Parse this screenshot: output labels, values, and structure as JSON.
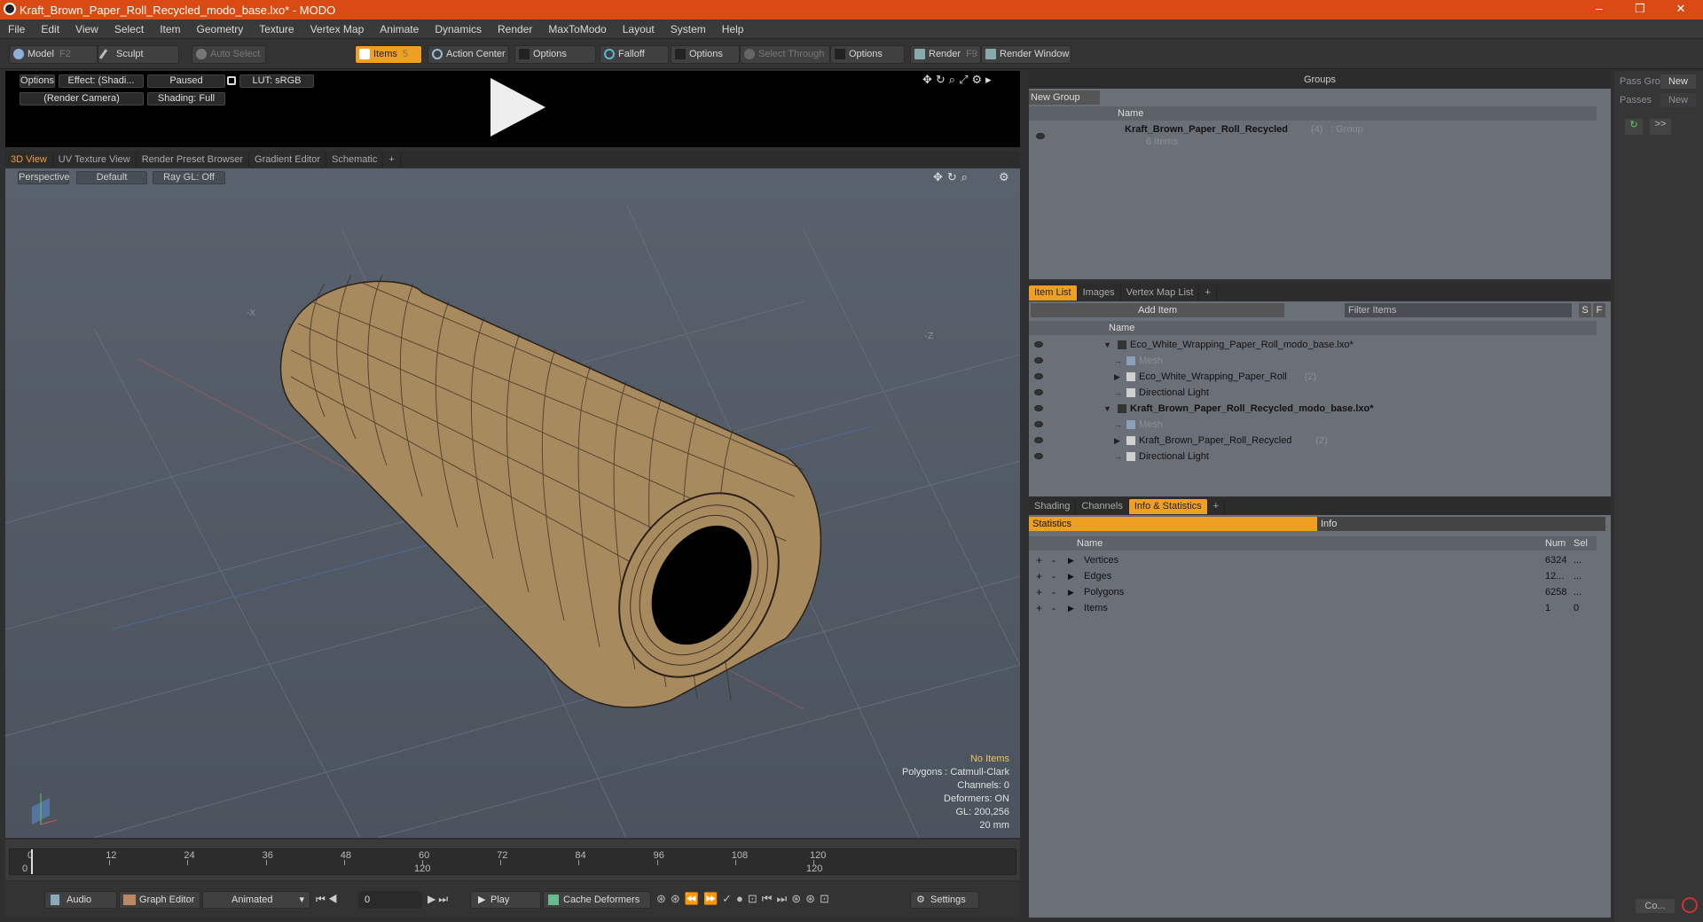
{
  "window": {
    "title": "Kraft_Brown_Paper_Roll_Recycled_modo_base.lxo* - MODO",
    "minimize": "–",
    "maximize": "❐",
    "close": "✕"
  },
  "menu": [
    "File",
    "Edit",
    "View",
    "Select",
    "Item",
    "Geometry",
    "Texture",
    "Vertex Map",
    "Animate",
    "Dynamics",
    "Render",
    "MaxToModo",
    "Layout",
    "System",
    "Help"
  ],
  "toolbar": {
    "model": "Model",
    "model_key": "F2",
    "sculpt": "Sculpt",
    "auto_select": "Auto Select",
    "items": "Items",
    "items_key": "5",
    "action_center": "Action Center",
    "options1": "Options",
    "falloff": "Falloff",
    "options2": "Options",
    "select_through": "Select Through",
    "options3": "Options",
    "render": "Render",
    "render_key": "F9",
    "render_window": "Render Window"
  },
  "preview": {
    "options": "Options",
    "effect": "Effect: (Shadi...",
    "paused": "Paused",
    "lut": "LUT: sRGB",
    "camera": "(Render Camera)",
    "shading": "Shading: Full"
  },
  "viewport_tabs": [
    "3D View",
    "UV Texture View",
    "Render Preset Browser",
    "Gradient Editor",
    "Schematic",
    "+"
  ],
  "viewport": {
    "perspective": "Perspective",
    "default": "Default",
    "raygl": "Ray GL: Off",
    "axis_x": "-X",
    "axis_z": "-Z"
  },
  "overlay": {
    "no_items": "No Items",
    "polygons": "Polygons : Catmull-Clark",
    "channels": "Channels: 0",
    "deformers": "Deformers: ON",
    "gl": "GL: 200,256",
    "units": "20 mm"
  },
  "timeline": {
    "ticks": [
      "0",
      "12",
      "24",
      "36",
      "48",
      "60",
      "72",
      "84",
      "96",
      "108",
      "120"
    ],
    "lower": [
      "0",
      "120",
      "120"
    ]
  },
  "bottom": {
    "audio": "Audio",
    "graph_editor": "Graph Editor",
    "animated": "Animated",
    "frame": "0",
    "play": "Play",
    "cache_deformers": "Cache Deformers",
    "settings": "Settings"
  },
  "groups": {
    "title": "Groups",
    "new_group": "New Group",
    "col_name": "Name",
    "item_name": "Kraft_Brown_Paper_Roll_Recycled",
    "item_count": "(4)",
    "item_type": ": Group",
    "item_sub": "6 Items"
  },
  "right_strip": {
    "pass_groups": "Pass Gro",
    "new1": "New",
    "passes": "Passes",
    "new2": "New",
    "more": ">>",
    "co": "Co..."
  },
  "item_list": {
    "tabs": [
      "Item List",
      "Images",
      "Vertex Map List",
      "+"
    ],
    "add_item": "Add Item",
    "filter": "Filter Items",
    "s": "S",
    "f": "F",
    "col_name": "Name",
    "rows": [
      {
        "label": "Eco_White_Wrapping_Paper_Roll_modo_base.lxo*",
        "indent": 0,
        "style": "normal"
      },
      {
        "label": "Mesh",
        "indent": 2,
        "style": "dim"
      },
      {
        "label": "Eco_White_Wrapping_Paper_Roll",
        "count": "(2)",
        "indent": 2,
        "style": "normal"
      },
      {
        "label": "Directional Light",
        "indent": 2,
        "style": "normal"
      },
      {
        "label": "Kraft_Brown_Paper_Roll_Recycled_modo_base.lxo*",
        "indent": 0,
        "style": "bold"
      },
      {
        "label": "Mesh",
        "indent": 2,
        "style": "dim"
      },
      {
        "label": "Kraft_Brown_Paper_Roll_Recycled",
        "count": "(2)",
        "indent": 2,
        "style": "normal"
      },
      {
        "label": "Directional Light",
        "indent": 2,
        "style": "normal"
      }
    ]
  },
  "info": {
    "tabs": [
      "Shading",
      "Channels",
      "Info & Statistics",
      "+"
    ],
    "statistics": "Statistics",
    "info": "Info",
    "col_name": "Name",
    "col_num": "Num",
    "col_sel": "Sel",
    "rows": [
      {
        "name": "Vertices",
        "num": "6324",
        "sel": "..."
      },
      {
        "name": "Edges",
        "num": "12...",
        "sel": "..."
      },
      {
        "name": "Polygons",
        "num": "6258",
        "sel": "..."
      },
      {
        "name": "Items",
        "num": "1",
        "sel": "0"
      }
    ]
  },
  "colors": {
    "accent": "#f0a020",
    "title_bar": "#d94a14",
    "paper": "#a88a5f"
  }
}
